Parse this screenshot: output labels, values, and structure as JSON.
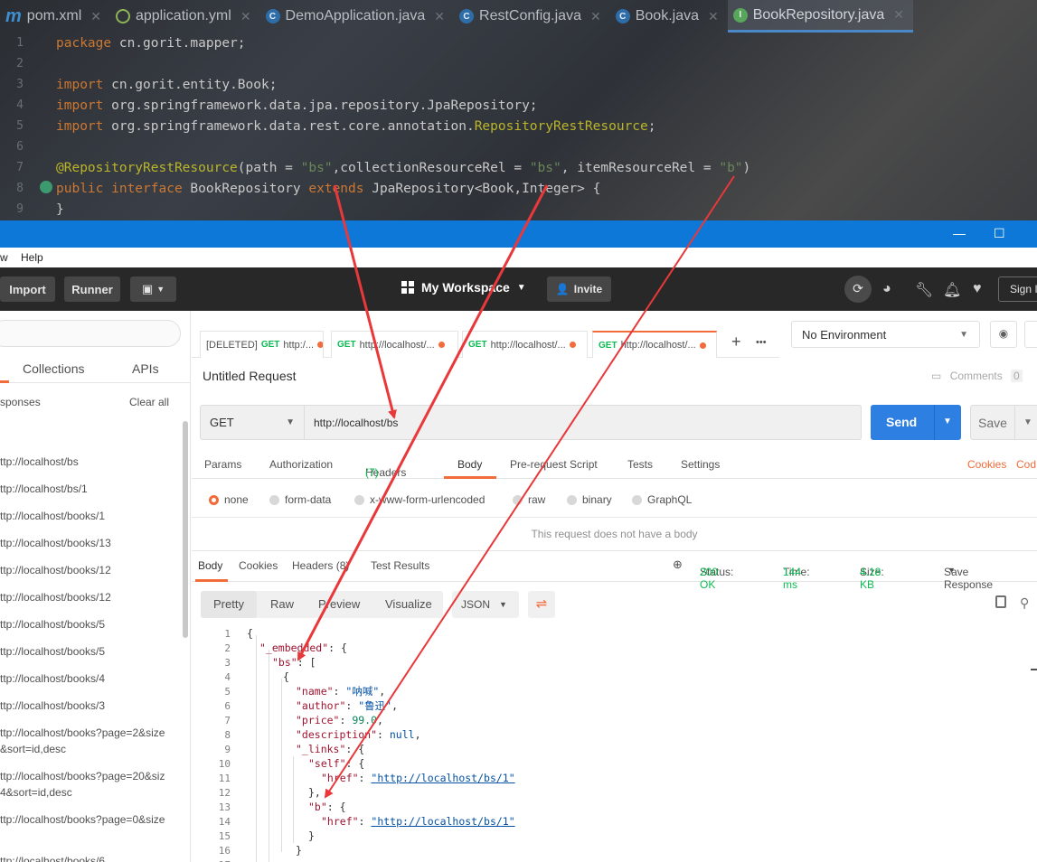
{
  "ide": {
    "tabs": [
      {
        "label": "pom.xml",
        "icon": "maven-icon"
      },
      {
        "label": "application.yml",
        "icon": "yml-icon"
      },
      {
        "label": "DemoApplication.java",
        "icon": "class-icon"
      },
      {
        "label": "RestConfig.java",
        "icon": "class-icon"
      },
      {
        "label": "Book.java",
        "icon": "class-icon"
      },
      {
        "label": "BookRepository.java",
        "icon": "interface-icon"
      }
    ],
    "line_numbers": [
      "1",
      "2",
      "3",
      "4",
      "5",
      "6",
      "7",
      "8",
      "9"
    ],
    "code": {
      "l1_kw": "package",
      "l1_rest": " cn.gorit.mapper;",
      "l3_kw": "import",
      "l3_rest": " cn.gorit.entity.Book;",
      "l4_kw": "import",
      "l4_rest": " org.springframework.data.jpa.repository.JpaRepository;",
      "l5_kw": "import",
      "l5_rest": " org.springframework.data.rest.core.annotation.",
      "l5_an": "RepositoryRestResource",
      "l5_end": ";",
      "l7_an": "@RepositoryRestResource",
      "l7_a": "(path = ",
      "l7_s1": "\"bs\"",
      "l7_b": ",collectionResourceRel = ",
      "l7_s2": "\"bs\"",
      "l7_c": ", itemResourceRel = ",
      "l7_s3": "\"b\"",
      "l7_d": ")",
      "l8_kw1": "public interface",
      "l8_a": " BookRepository ",
      "l8_kw2": "extends",
      "l8_b": " JpaRepository<Book,Integer> {",
      "l9": "}"
    }
  },
  "window": {
    "menu": [
      "w",
      "Help"
    ],
    "minimize": "—",
    "maximize": "☐"
  },
  "header": {
    "import": "Import",
    "runner": "Runner",
    "workspace": "My Workspace",
    "invite": "Invite",
    "signin": "Sign I"
  },
  "sidebar": {
    "tabs": [
      "Collections",
      "APIs"
    ],
    "responses_label": "sponses",
    "clear_all": "Clear all",
    "history": [
      [
        "ttp://localhost/bs"
      ],
      [
        "ttp://localhost/bs/1"
      ],
      [
        "ttp://localhost/books/1"
      ],
      [
        "ttp://localhost/books/13"
      ],
      [
        "ttp://localhost/books/12"
      ],
      [
        "ttp://localhost/books/12"
      ],
      [
        "ttp://localhost/books/5"
      ],
      [
        "ttp://localhost/books/5"
      ],
      [
        "ttp://localhost/books/4"
      ],
      [
        "ttp://localhost/books/3"
      ],
      [
        "ttp://localhost/books?page=2&size",
        "&sort=id,desc"
      ],
      [
        "ttp://localhost/books?page=20&siz",
        "4&sort=id,desc"
      ],
      [
        "ttp://localhost/books?page=0&size",
        ""
      ],
      [
        "ttp://localhost/books/6"
      ]
    ]
  },
  "request_tabs": [
    {
      "prefix": "[DELETED]",
      "method": "GET",
      "url": "http:/..."
    },
    {
      "prefix": "",
      "method": "GET",
      "url": "http://localhost/..."
    },
    {
      "prefix": "",
      "method": "GET",
      "url": "http://localhost/..."
    },
    {
      "prefix": "",
      "method": "GET",
      "url": "http://localhost/..."
    }
  ],
  "request_tab_controls": {
    "add": "+",
    "more": "•••"
  },
  "environment": "No Environment",
  "request": {
    "title": "Untitled Request",
    "comments_label": "Comments",
    "comments_count": "0",
    "method": "GET",
    "url": "http://localhost/bs",
    "send": "Send",
    "save": "Save"
  },
  "param_tabs": {
    "params": "Params",
    "authorization": "Authorization",
    "headers": "Headers",
    "headers_count": "(7)",
    "body": "Body",
    "prerequest": "Pre-request Script",
    "tests": "Tests",
    "settings": "Settings",
    "cookies": "Cookies",
    "code": "Cod"
  },
  "body_types": [
    "none",
    "form-data",
    "x-www-form-urlencoded",
    "raw",
    "binary",
    "GraphQL"
  ],
  "no_body_message": "This request does not have a body",
  "response": {
    "tabs": {
      "body": "Body",
      "cookies": "Cookies",
      "headers": "Headers (8)",
      "tests": "Test Results"
    },
    "status_label": "Status:",
    "status_value": "200 OK",
    "time_label": "Time:",
    "time_value": "144 ms",
    "size_label": "Size:",
    "size_value": "4.18 KB",
    "save_response": "Save Response",
    "views": [
      "Pretty",
      "Raw",
      "Preview",
      "Visualize"
    ],
    "format": "JSON"
  },
  "json_lines": {
    "n": [
      "1",
      "2",
      "3",
      "4",
      "5",
      "6",
      "7",
      "8",
      "9",
      "10",
      "11",
      "12",
      "13",
      "14",
      "15",
      "16",
      "17"
    ],
    "l1": "{",
    "l2k": "\"_embedded\"",
    "l2r": ": {",
    "l3k": "\"bs\"",
    "l3r": ": [",
    "l4": "{",
    "l5k": "\"name\"",
    "l5v": "\"呐喊\"",
    "l5r": ",",
    "l6k": "\"author\"",
    "l6v": "\"鲁迅\"",
    "l6r": ",",
    "l7k": "\"price\"",
    "l7v": "99.0",
    "l7r": ",",
    "l8k": "\"description\"",
    "l8v": "null",
    "l8r": ",",
    "l9k": "\"_links\"",
    "l9r": ": {",
    "l10k": "\"self\"",
    "l10r": ": {",
    "l11k": "\"href\"",
    "l11m": ": ",
    "l11v": "\"http://localhost/bs/1\"",
    "l12": "},",
    "l13k": "\"b\"",
    "l13r": ": {",
    "l14k": "\"href\"",
    "l14m": ": ",
    "l14v": "\"http://localhost/bs/1\"",
    "l15": "}",
    "l16": "}"
  },
  "colors": {
    "accent": "#f26b3a",
    "send_blue": "#2d7fe1",
    "status_green": "#0cbb52",
    "arrow_red": "#e8383a",
    "titlebar_blue": "#0d78d7"
  }
}
